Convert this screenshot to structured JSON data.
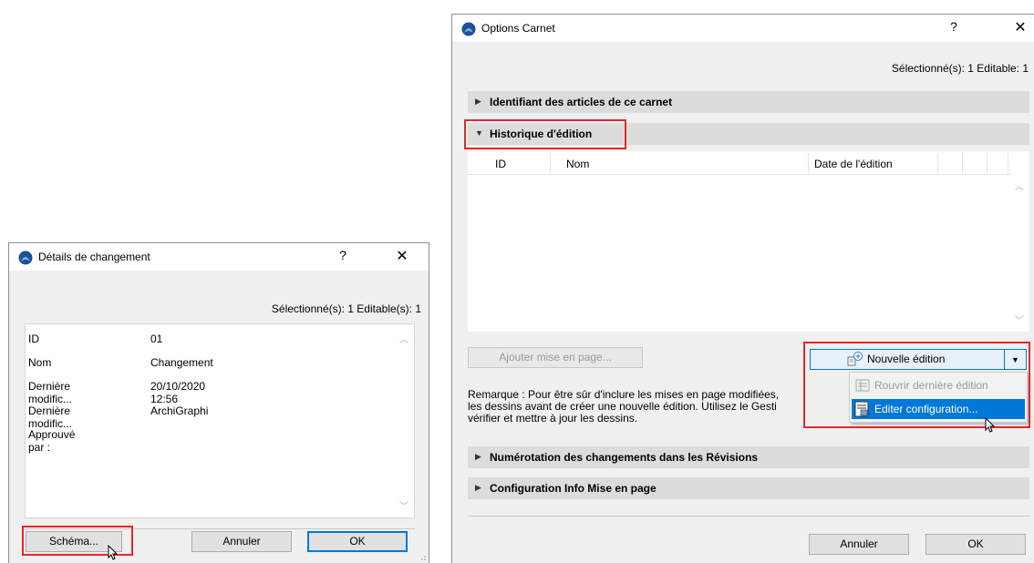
{
  "left_dialog": {
    "title": "Détails de changement",
    "help": "?",
    "close": "✕",
    "selection_status": "Sélectionné(s): 1 Editable(s): 1",
    "properties": [
      {
        "key": "ID",
        "value": "01"
      },
      {
        "key": "Nom",
        "value": "Changement"
      },
      {
        "key": "Dernière modific...",
        "value": "20/10/2020 12:56"
      },
      {
        "key": "Dernière modific...",
        "value": "ArchiGraphi"
      },
      {
        "key": "Approuvé par :",
        "value": ""
      }
    ],
    "buttons": {
      "schema": "Schéma...",
      "cancel": "Annuler",
      "ok": "OK"
    }
  },
  "right_dialog": {
    "title": "Options Carnet",
    "help": "?",
    "close": "✕",
    "selection_status": "Sélectionné(s): 1 Editable: 1",
    "sections": {
      "identifiant": "Identifiant des articles de ce carnet",
      "historique": "Historique d'édition",
      "numerotation": "Numérotation des changements dans les Révisions",
      "configuration": "Configuration Info Mise en page"
    },
    "table_headers": {
      "id": "ID",
      "nom": "Nom",
      "date": "Date de l'édition"
    },
    "add_layout_button": "Ajouter mise en page...",
    "new_edition_button": "Nouvelle édition",
    "dropdown": {
      "reopen": "Rouvrir dernière édition",
      "edit_config": "Editer configuration..."
    },
    "remark": [
      "Remarque : Pour être sûr d'inclure les mises en page modifiées,",
      "les dessins avant de créer une nouvelle édition. Utilisez le Gesti",
      "vérifier et mettre à jour les dessins."
    ],
    "buttons": {
      "cancel": "Annuler",
      "ok": "OK"
    }
  },
  "colors": {
    "highlight_red": "#e8262a",
    "menu_selected": "#0078d7",
    "section_bg": "#dcdcdc"
  },
  "icons": [
    "archicad-app-icon",
    "help-icon",
    "close-icon",
    "triangle-right-icon",
    "triangle-down-icon",
    "scroll-up-icon",
    "scroll-down-icon",
    "new-edition-icon",
    "reopen-icon",
    "edit-config-icon",
    "dropdown-arrow-icon",
    "mouse-cursor-icon"
  ]
}
